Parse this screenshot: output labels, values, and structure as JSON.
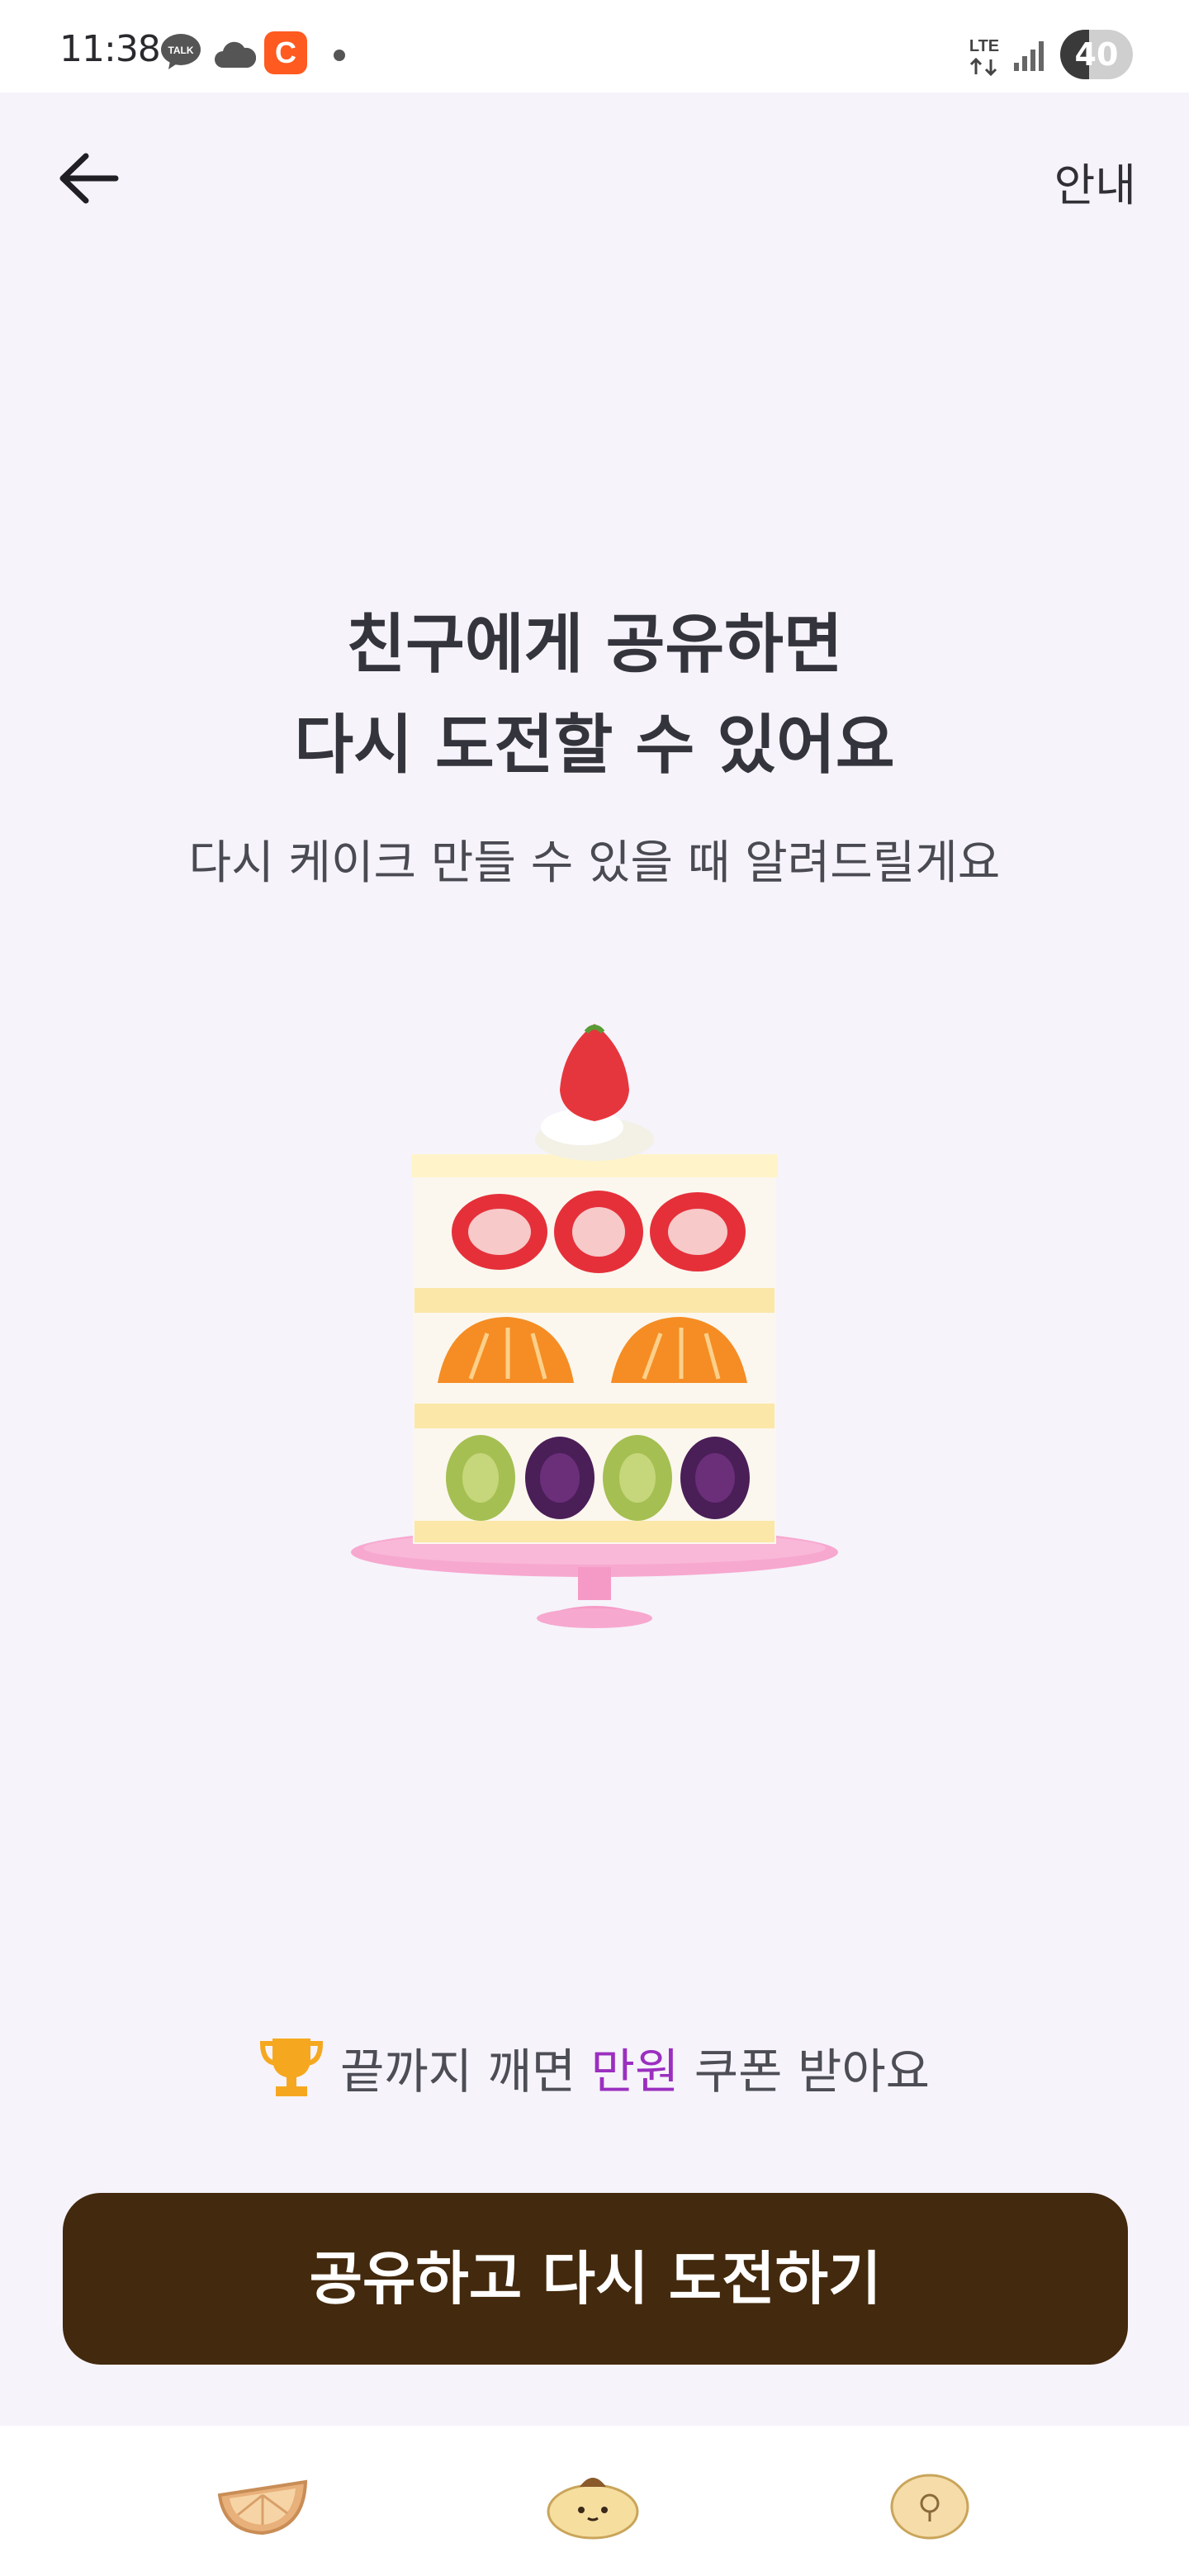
{
  "status_bar": {
    "time": "11:38",
    "icons": [
      "talk-icon",
      "cloud-icon",
      "c-app-icon",
      "dot-icon",
      "lte-icon",
      "signal-icon",
      "battery-icon"
    ],
    "lte_label": "LTE",
    "battery_level": "40"
  },
  "header": {
    "back_icon": "arrow-left-icon",
    "info_label": "안내"
  },
  "main": {
    "title_line1": "친구에게 공유하면",
    "title_line2": "다시 도전할 수 있어요",
    "subtitle": "다시 케이크 만들 수 있을 때 알려드릴게요",
    "illustration": "layered-fruit-cake"
  },
  "reward": {
    "icon": "trophy-icon",
    "prefix": "끝까지 깨면",
    "highlight": "만원",
    "suffix": "쿠폰 받아요"
  },
  "cta": {
    "label": "공유하고 다시 도전하기"
  },
  "bottom_nav": {
    "items": [
      "orange-slice-icon",
      "pompompurin-icon",
      "round-character-icon"
    ]
  },
  "colors": {
    "background": "#f6f3fb",
    "cta_background": "#43290d",
    "highlight": "#9b2fbf",
    "cake_stand": "#f7a8cf"
  }
}
